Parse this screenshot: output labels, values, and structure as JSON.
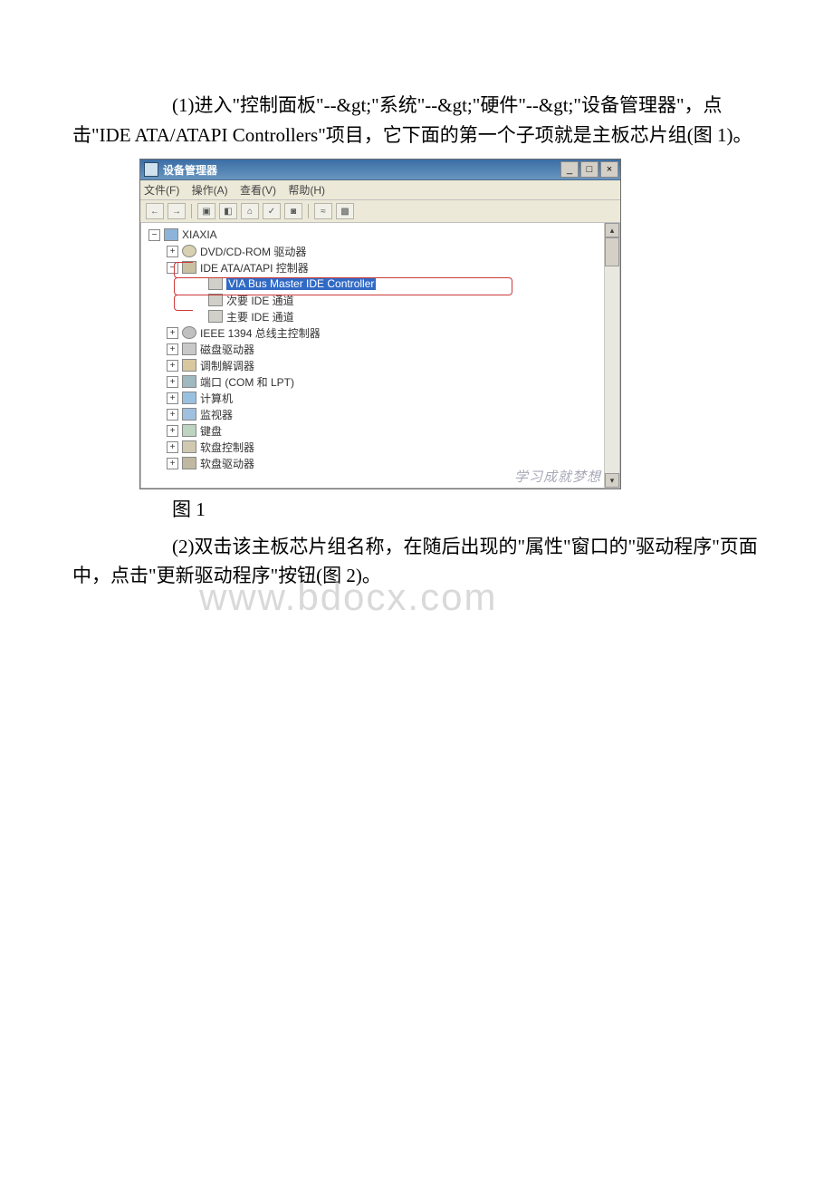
{
  "paragraphs": {
    "p1": "(1)进入\"控制面板\"--&gt;\"系统\"--&gt;\"硬件\"--&gt;\"设备管理器\"，点击\"IDE ATA/ATAPI Controllers\"项目，它下面的第一个子项就是主板芯片组(图 1)。",
    "caption1": "图 1",
    "p2": "(2)双击该主板芯片组名称，在随后出现的\"属性\"窗口的\"驱动程序\"页面中，点击\"更新驱动程序\"按钮(图 2)。"
  },
  "watermark": "www.bdocx.com",
  "device_manager": {
    "window_title": "设备管理器",
    "window_controls": {
      "min": "_",
      "max": "□",
      "close": "×"
    },
    "menubar": [
      "文件(F)",
      "操作(A)",
      "查看(V)",
      "帮助(H)"
    ],
    "toolbar_icons": [
      "←",
      "→",
      "▣",
      "◧",
      "⌂",
      "✓",
      "◙",
      "≈",
      "▩"
    ],
    "root": "XIAXIA",
    "items": {
      "dvd": "DVD/CD-ROM 驱动器",
      "ide": "IDE ATA/ATAPI 控制器",
      "via": "VIA Bus Master IDE Controller",
      "sec_ide": "次要 IDE 通道",
      "pri_ide": "主要 IDE 通道",
      "ieee": "IEEE 1394 总线主控制器",
      "disk": "磁盘驱动器",
      "modem": "调制解调器",
      "port": "端口 (COM 和 LPT)",
      "computer": "计算机",
      "monitor": "监视器",
      "keyboard": "键盘",
      "floppy_c": "软盘控制器",
      "floppy": "软盘驱动器"
    },
    "scroll_arrows": {
      "up": "▴",
      "down": "▾"
    },
    "bottom_watermark": "学习成就梦想"
  }
}
